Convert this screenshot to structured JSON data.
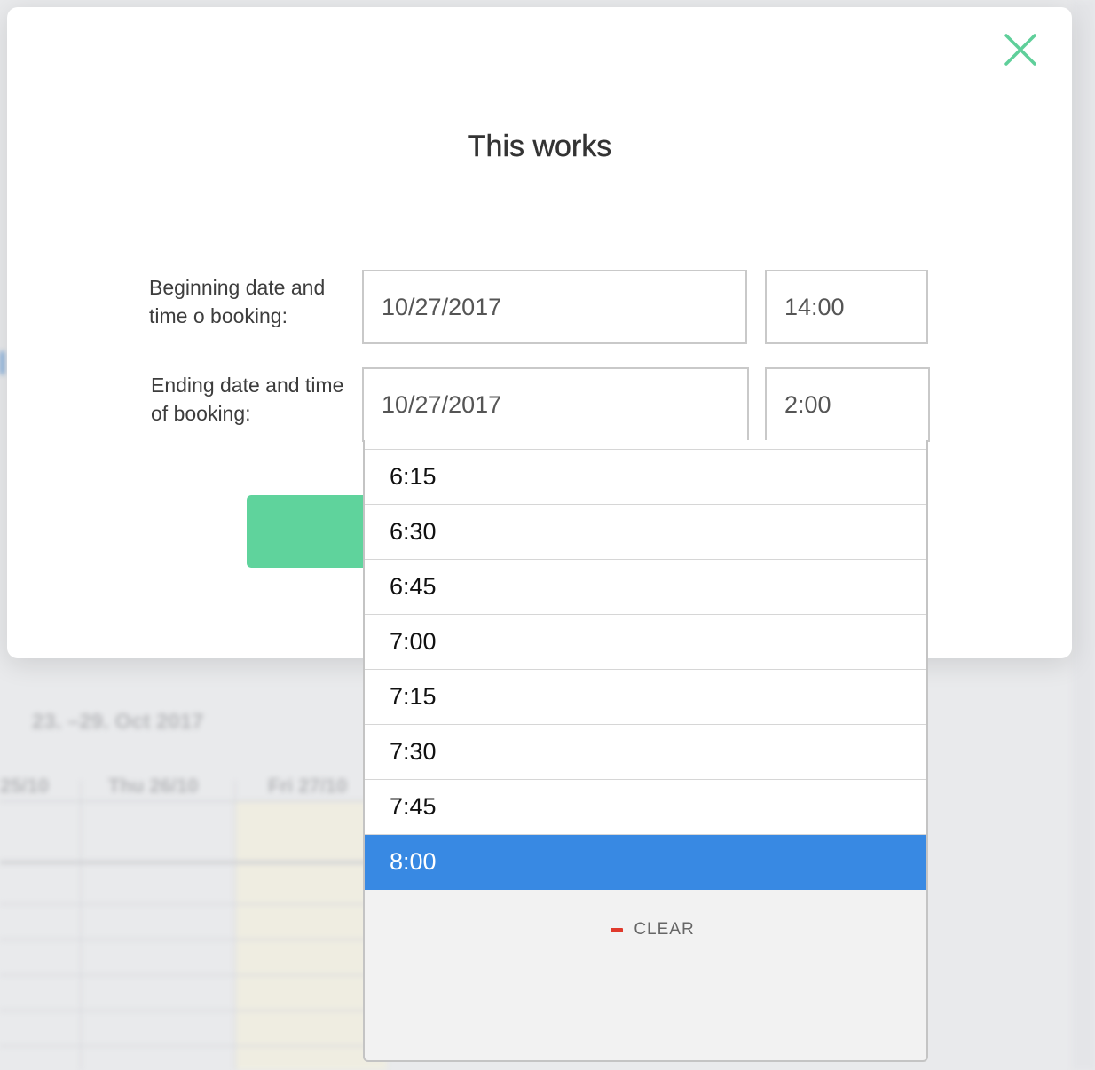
{
  "background": {
    "week_range": "23. –29. Oct 2017",
    "days": [
      "25/10",
      "Thu 26/10",
      "Fri 27/10"
    ]
  },
  "modal": {
    "title": "This works",
    "close_icon": "close-x-icon",
    "beginning": {
      "label_line1": "Beginning date and",
      "label_line2": "time o booking:",
      "date_value": "10/27/2017",
      "time_value": "14:00"
    },
    "ending": {
      "label_line1": "Ending date and time",
      "label_line2": "of booking:",
      "date_value": "10/27/2017",
      "time_value": "2:00"
    },
    "submit_label": ""
  },
  "time_dropdown": {
    "options": [
      "6:15",
      "6:30",
      "6:45",
      "7:00",
      "7:15",
      "7:30",
      "7:45",
      "8:00"
    ],
    "selected": "8:00",
    "clear_label": "CLEAR",
    "clear_icon": "minus-icon"
  },
  "colors": {
    "accent_green": "#5fd39c",
    "selected_blue": "#3889e3",
    "clear_red": "#e03a2c"
  }
}
